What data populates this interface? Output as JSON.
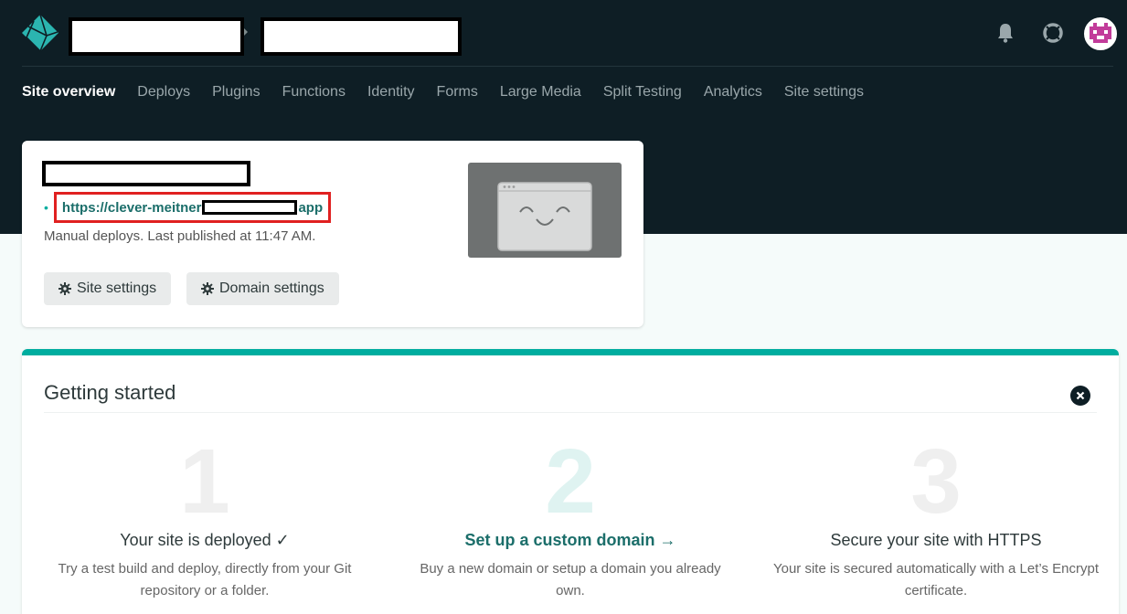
{
  "nav": {
    "items": [
      {
        "label": "Site overview",
        "active": true
      },
      {
        "label": "Deploys"
      },
      {
        "label": "Plugins"
      },
      {
        "label": "Functions"
      },
      {
        "label": "Identity"
      },
      {
        "label": "Forms"
      },
      {
        "label": "Large Media"
      },
      {
        "label": "Split Testing"
      },
      {
        "label": "Analytics"
      },
      {
        "label": "Site settings"
      }
    ]
  },
  "topbar": {
    "icons": [
      "bell-icon",
      "help-lifebuoy-icon",
      "avatar"
    ]
  },
  "site_card": {
    "url_prefix": "https://clever-meitner",
    "url_suffix": "app",
    "deploy_status": "Manual deploys. Last published at 11:47 AM.",
    "site_settings_label": "Site settings",
    "domain_settings_label": "Domain settings"
  },
  "getting_started": {
    "title": "Getting started",
    "steps": [
      {
        "number": "1",
        "title": "Your site is deployed ✓",
        "desc": "Try a test build and deploy, directly from your Git repository or a folder."
      },
      {
        "number": "2",
        "title": "Set up a custom domain →",
        "desc": "Buy a new domain or setup a domain you already own."
      },
      {
        "number": "3",
        "title": "Secure your site with HTTPS",
        "desc": "Your site is secured automatically with a Let’s Encrypt certificate."
      }
    ]
  },
  "colors": {
    "topbar_bg": "#0e1e25",
    "accent": "#00ad9f",
    "link": "#1b6e6a",
    "highlight_border": "#e02020"
  }
}
